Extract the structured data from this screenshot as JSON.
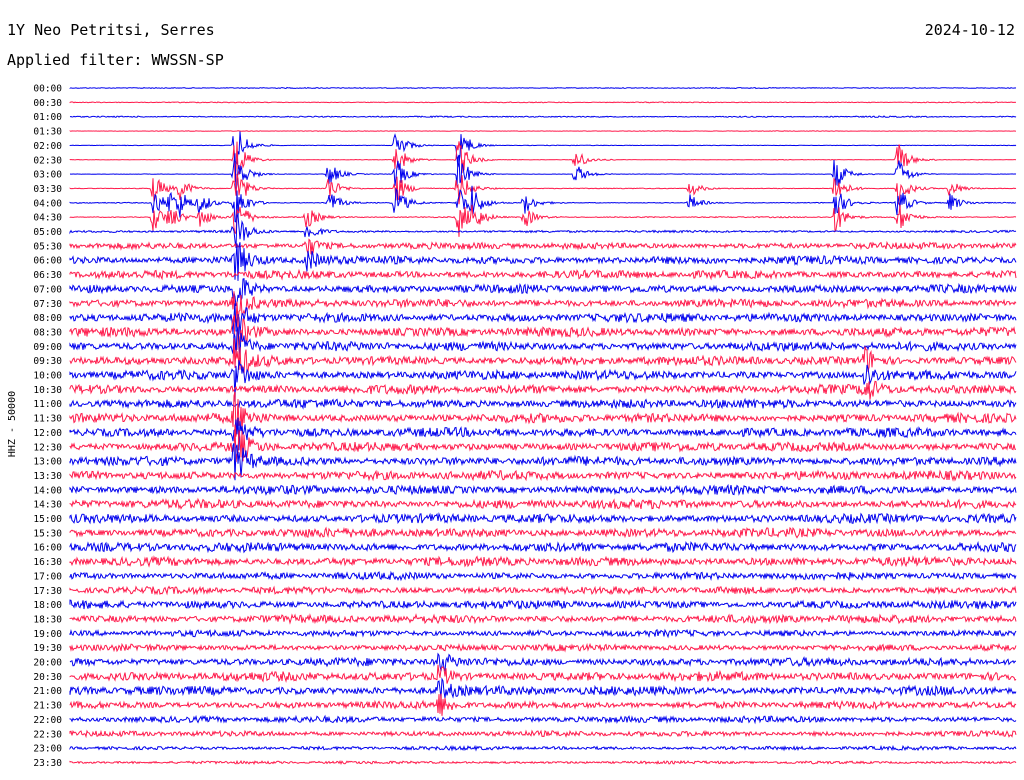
{
  "header": {
    "station": "1Y Neo Petritsi, Serres",
    "date": "2024-10-12",
    "filter": "Applied filter: WWSSN-SP",
    "channel": "HHZ - 50000"
  },
  "colors": {
    "trace_a": "#0000ee",
    "trace_b": "#ff1a4b",
    "text": "#000000",
    "background": "#ffffff"
  },
  "chart_data": {
    "type": "line",
    "title": "1Y Neo Petritsi, Serres",
    "date": "2024-10-12",
    "filter": "WWSSN-SP",
    "ylabel": "HHZ - 50000",
    "xlabel": "",
    "row_labels": [
      "00:00",
      "00:30",
      "01:00",
      "01:30",
      "02:00",
      "02:30",
      "03:00",
      "03:30",
      "04:00",
      "04:30",
      "05:00",
      "05:30",
      "06:00",
      "06:30",
      "07:00",
      "07:30",
      "08:00",
      "08:30",
      "09:00",
      "09:30",
      "10:00",
      "10:30",
      "11:00",
      "11:30",
      "12:00",
      "12:30",
      "13:00",
      "13:30",
      "14:00",
      "14:30",
      "15:00",
      "15:30",
      "16:00",
      "16:30",
      "17:00",
      "17:30",
      "18:00",
      "18:30",
      "19:00",
      "19:30",
      "20:00",
      "20:30",
      "21:00",
      "21:30",
      "22:00",
      "22:30",
      "23:00",
      "23:30"
    ],
    "series_colors": [
      "#0000ee",
      "#ff1a4b"
    ],
    "noise_level": [
      0.5,
      0.5,
      0.7,
      0.3,
      0.3,
      0.3,
      0.3,
      0.4,
      0.5,
      0.6,
      1.2,
      3.5,
      4.5,
      4.5,
      4.5,
      4.5,
      5,
      5,
      5,
      5,
      5,
      5,
      5,
      5,
      5,
      5,
      5,
      5,
      5,
      5,
      5,
      5,
      5,
      5,
      4,
      4,
      4.5,
      4.5,
      3.5,
      3.5,
      4.5,
      5,
      5,
      4,
      3.5,
      3,
      2,
      1.5
    ],
    "events": [
      {
        "x": 0.273,
        "rows": [
          6,
          7,
          8
        ],
        "amp": 14
      },
      {
        "x": 0.534,
        "rows": [
          5,
          6
        ],
        "amp": 12
      },
      {
        "x": 0.655,
        "rows": [
          7,
          8
        ],
        "amp": 9
      },
      {
        "x": 0.808,
        "rows": [
          6,
          7,
          8,
          9
        ],
        "amp": 18
      },
      {
        "x": 0.875,
        "rows": [
          5,
          6,
          7,
          8,
          9
        ],
        "amp": 18
      },
      {
        "x": 0.088,
        "rows": [
          7,
          8,
          9
        ],
        "amp": 16
      },
      {
        "x": 0.105,
        "rows": [
          8,
          9
        ],
        "amp": 12
      },
      {
        "x": 0.115,
        "rows": [
          7,
          8
        ],
        "amp": 12
      },
      {
        "x": 0.137,
        "rows": [
          8,
          9
        ],
        "amp": 12
      },
      {
        "x": 0.174,
        "rows": [
          4,
          5,
          6,
          7,
          8,
          9,
          10,
          12,
          14,
          15,
          16,
          17,
          18,
          19,
          20,
          23,
          24,
          25,
          26
        ],
        "amp": 26
      },
      {
        "x": 0.344,
        "rows": [
          4,
          5,
          6,
          7,
          8
        ],
        "amp": 18
      },
      {
        "x": 0.41,
        "rows": [
          4,
          5,
          6,
          7,
          8,
          9
        ],
        "amp": 22
      },
      {
        "x": 0.425,
        "rows": [
          8,
          9
        ],
        "amp": 14
      },
      {
        "x": 0.48,
        "rows": [
          8,
          9
        ],
        "amp": 12
      },
      {
        "x": 0.25,
        "rows": [
          9,
          10,
          11,
          12
        ],
        "amp": 12
      },
      {
        "x": 0.93,
        "rows": [
          7,
          8
        ],
        "amp": 10
      },
      {
        "x": 0.84,
        "rows": [
          19,
          20,
          21
        ],
        "amp": 14
      },
      {
        "x": 0.39,
        "rows": [
          40,
          41,
          42,
          43
        ],
        "amp": 12
      }
    ]
  }
}
